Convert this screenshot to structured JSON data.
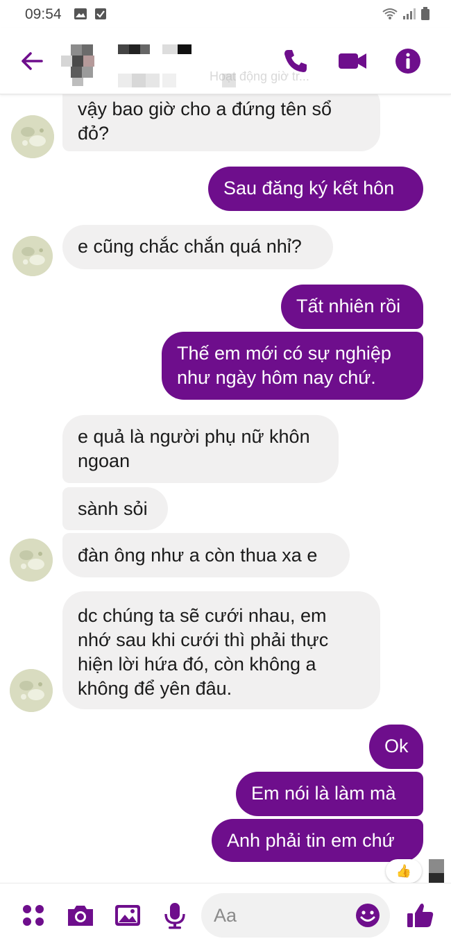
{
  "status_bar": {
    "time": "09:54"
  },
  "header": {
    "subtitle": "Hoạt động giờ tr..."
  },
  "messages": [
    {
      "side": "in",
      "text_lines": [
        "vậy bao giờ cho a đứng tên sổ",
        "đỏ?"
      ]
    },
    {
      "side": "out",
      "text": "Sau đăng ký kết hôn"
    },
    {
      "side": "in",
      "text": "e cũng chắc chắn quá nhỉ?"
    },
    {
      "side": "out",
      "text": "Tất nhiên rồi"
    },
    {
      "side": "out",
      "text_lines": [
        "Thế em mới có sự nghiệp",
        "như ngày hôm nay chứ."
      ]
    },
    {
      "side": "in",
      "text_lines": [
        "e quả là người phụ nữ khôn",
        "ngoan"
      ]
    },
    {
      "side": "in",
      "text": "sành sỏi"
    },
    {
      "side": "in",
      "text": "đàn ông như a còn thua xa e"
    },
    {
      "side": "in",
      "text_lines": [
        "dc chúng ta sẽ cưới nhau, em",
        "nhớ sau khi cưới thì phải thực",
        "hiện lời hứa đó, còn không a",
        "không để yên đâu."
      ]
    },
    {
      "side": "out",
      "text": "Ok"
    },
    {
      "side": "out",
      "text": "Em nói là làm mà"
    },
    {
      "side": "out",
      "text": "Anh phải tin em chứ"
    }
  ],
  "reaction": {
    "emoji": "👍"
  },
  "composer": {
    "placeholder": "Aa"
  },
  "icons": {
    "back": "back-arrow-icon",
    "call": "phone-icon",
    "video": "video-camera-icon",
    "info": "info-icon",
    "apps": "apps-grid-icon",
    "camera": "camera-icon",
    "gallery": "image-icon",
    "mic": "microphone-icon",
    "emoji": "emoji-icon",
    "like": "thumbs-up-icon"
  },
  "colors": {
    "accent": "#6e0e8c",
    "incoming_bubble": "#f1f0f0",
    "background": "#ffffff"
  }
}
